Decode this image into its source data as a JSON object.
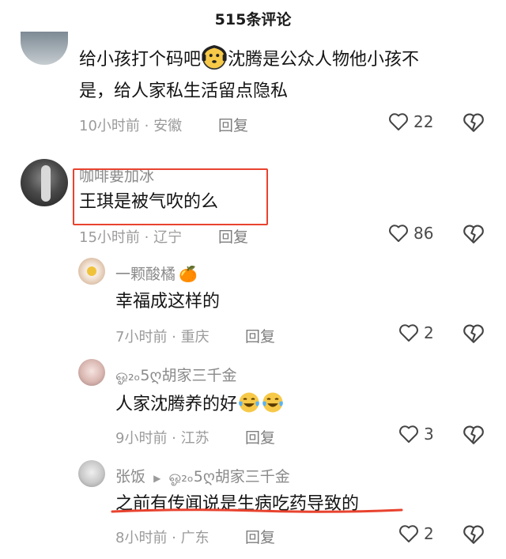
{
  "header": {
    "title": "515条评论"
  },
  "comments": [
    {
      "text_line1": "给小孩打个码吧",
      "text_line1_after": "沈腾是公众人物他小孩不",
      "text_line2": "是，给人家私生活留点隐私",
      "meta": "10小时前 · 安徽",
      "reply": "回复",
      "likes": "22",
      "emoji_icon": "thinking-face-icon"
    },
    {
      "username": "咖啡要加冰",
      "text": "王琪是被气吹的么",
      "meta": "15小时前 · 辽宁",
      "reply": "回复",
      "likes": "86"
    },
    {
      "username": "一颗酸橘",
      "username_emoji": "🍊",
      "text": "幸福成这样的",
      "meta": "7小时前 · 重庆",
      "reply": "回复",
      "likes": "2"
    },
    {
      "username": "ஓ₂ₒ5ღ胡家三千金",
      "text": "人家沈腾养的好",
      "meta": "9小时前 · 江苏",
      "reply": "回复",
      "likes": "3",
      "emoji_icon": "tears-of-joy-icon"
    },
    {
      "username": "张饭",
      "reply_to": "ஓ₂ₒ5ღ胡家三千金",
      "text": "之前有传闻说是生病吃药导致的",
      "meta": "8小时前 · 广东",
      "reply": "回复",
      "likes": "2"
    }
  ],
  "colors": {
    "highlight": "#e8432f",
    "meta_text": "#9b9b9b"
  }
}
